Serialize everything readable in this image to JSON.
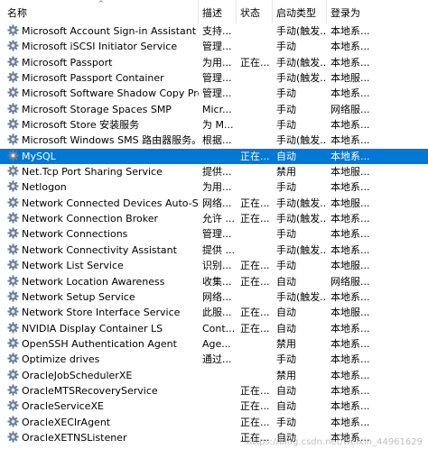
{
  "columns": {
    "name": "名称",
    "description": "描述",
    "status": "状态",
    "startup": "启动类型",
    "logon": "登录为"
  },
  "services": [
    {
      "name": "Microsoft Account Sign-in Assistant",
      "description": "支持...",
      "status": "",
      "startup": "手动(触发...",
      "logon": "本地系..."
    },
    {
      "name": "Microsoft iSCSI Initiator Service",
      "description": "管理...",
      "status": "",
      "startup": "手动",
      "logon": "本地系..."
    },
    {
      "name": "Microsoft Passport",
      "description": "为用...",
      "status": "正在...",
      "startup": "手动(触发...",
      "logon": "本地系..."
    },
    {
      "name": "Microsoft Passport Container",
      "description": "管理...",
      "status": "",
      "startup": "手动(触发...",
      "logon": "本地服..."
    },
    {
      "name": "Microsoft Software Shadow Copy Pro...",
      "description": "管理...",
      "status": "",
      "startup": "手动",
      "logon": "本地系..."
    },
    {
      "name": "Microsoft Storage Spaces SMP",
      "description": "Micr...",
      "status": "",
      "startup": "手动",
      "logon": "网络服..."
    },
    {
      "name": "Microsoft Store 安装服务",
      "description": "为 M...",
      "status": "",
      "startup": "手动",
      "logon": "本地系..."
    },
    {
      "name": "Microsoft Windows SMS 路由器服务。",
      "description": "根据...",
      "status": "",
      "startup": "手动(触发...",
      "logon": "本地系..."
    },
    {
      "name": "MySQL",
      "description": "",
      "status": "正在...",
      "startup": "自动",
      "logon": "本地系...",
      "selected": true
    },
    {
      "name": "Net.Tcp Port Sharing Service",
      "description": "提供...",
      "status": "",
      "startup": "禁用",
      "logon": "本地服..."
    },
    {
      "name": "Netlogon",
      "description": "为用...",
      "status": "",
      "startup": "手动",
      "logon": "本地系..."
    },
    {
      "name": "Network Connected Devices Auto-Set...",
      "description": "网络...",
      "status": "正在...",
      "startup": "手动(触发...",
      "logon": "本地服..."
    },
    {
      "name": "Network Connection Broker",
      "description": "允许 ...",
      "status": "正在...",
      "startup": "手动(触发...",
      "logon": "本地系..."
    },
    {
      "name": "Network Connections",
      "description": "管理...",
      "status": "",
      "startup": "手动",
      "logon": "本地系..."
    },
    {
      "name": "Network Connectivity Assistant",
      "description": "提供 ...",
      "status": "",
      "startup": "手动(触发...",
      "logon": "本地系..."
    },
    {
      "name": "Network List Service",
      "description": "识别...",
      "status": "正在...",
      "startup": "手动",
      "logon": "本地服..."
    },
    {
      "name": "Network Location Awareness",
      "description": "收集...",
      "status": "正在...",
      "startup": "自动",
      "logon": "网络服..."
    },
    {
      "name": "Network Setup Service",
      "description": "网络...",
      "status": "",
      "startup": "手动(触发...",
      "logon": "本地系..."
    },
    {
      "name": "Network Store Interface Service",
      "description": "此服...",
      "status": "正在...",
      "startup": "自动",
      "logon": "本地服..."
    },
    {
      "name": "NVIDIA Display Container LS",
      "description": "Cont...",
      "status": "正在...",
      "startup": "自动",
      "logon": "本地系..."
    },
    {
      "name": "OpenSSH Authentication Agent",
      "description": "Age...",
      "status": "",
      "startup": "禁用",
      "logon": "本地系..."
    },
    {
      "name": "Optimize drives",
      "description": "通过...",
      "status": "",
      "startup": "手动",
      "logon": "本地系..."
    },
    {
      "name": "OracleJobSchedulerXE",
      "description": "",
      "status": "",
      "startup": "禁用",
      "logon": "本地系..."
    },
    {
      "name": "OracleMTSRecoveryService",
      "description": "",
      "status": "正在...",
      "startup": "自动",
      "logon": "本地系..."
    },
    {
      "name": "OracleServiceXE",
      "description": "",
      "status": "正在...",
      "startup": "自动",
      "logon": "本地系..."
    },
    {
      "name": "OracleXEClrAgent",
      "description": "",
      "status": "正在...",
      "startup": "手动",
      "logon": "本地系..."
    },
    {
      "name": "OracleXETNSListener",
      "description": "",
      "status": "正在...",
      "startup": "自动",
      "logon": "本地系..."
    }
  ],
  "watermark": "https://blog.csdn.net/weixin_44961629",
  "colors": {
    "selection": "#0078d7",
    "gear_primary": "#6f7f95",
    "gear_hub": "#dfe7f3"
  }
}
